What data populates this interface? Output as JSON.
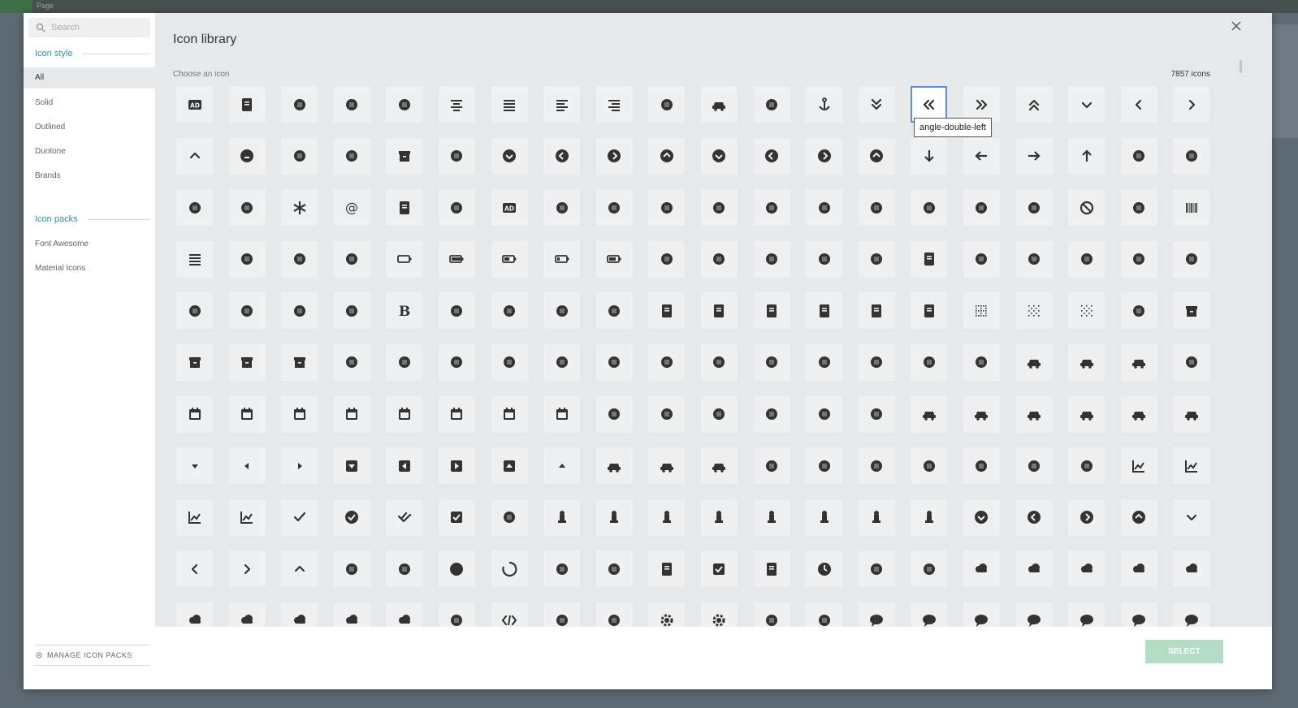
{
  "background": {
    "page_label": "Page"
  },
  "modal": {
    "title": "Icon library",
    "subtitle": "Choose an icon",
    "count_label": "7857 icons",
    "select_label": "SELECT",
    "tooltip": "angle-double-left"
  },
  "search": {
    "placeholder": "Search"
  },
  "sidebar": {
    "icon_style_heading": "Icon style",
    "styles": [
      "All",
      "Solid",
      "Outlined",
      "Duotone",
      "Brands"
    ],
    "packs_heading": "Icon packs",
    "packs": [
      "Font Awesome",
      "Material Icons"
    ],
    "manage_label": "MANAGE ICON PACKS"
  },
  "colors": {
    "accent": "#3a8aa3",
    "icon": "#333333",
    "select_button": "#b5dcc5",
    "selected_border": "#5b8fcf"
  },
  "icons": [
    "ad",
    "address-book",
    "address-card",
    "adjust",
    "air-freshener",
    "align-center",
    "align-justify",
    "align-left",
    "align-right",
    "allergies",
    "ambulance",
    "american-sign-language-interpreting",
    "anchor",
    "angle-double-down",
    "angle-double-left",
    "angle-double-right",
    "angle-double-up",
    "angle-down",
    "angle-left",
    "angle-right",
    "angle-up",
    "angry",
    "ankh",
    "apple-alt",
    "archive",
    "archway",
    "arrow-alt-circle-down",
    "arrow-alt-circle-left",
    "arrow-alt-circle-right",
    "arrow-alt-circle-up",
    "arrow-circle-down",
    "arrow-circle-left",
    "arrow-circle-right",
    "arrow-circle-up",
    "arrow-down",
    "arrow-left",
    "arrow-right",
    "arrow-up",
    "arrows-alt",
    "arrows-alt-h",
    "arrows-alt-v",
    "assistive-listening-systems",
    "asterisk",
    "at",
    "atlas",
    "atom",
    "audio-description",
    "award",
    "baby",
    "baby-carriage",
    "backspace",
    "backward",
    "bacon",
    "bahai",
    "balance-scale",
    "balance-scale-left",
    "balance-scale-right",
    "ban",
    "band-aid",
    "barcode",
    "bars",
    "baseball-ball",
    "basketball-ball",
    "bath",
    "battery-empty",
    "battery-full",
    "battery-half",
    "battery-quarter",
    "battery-three-quarters",
    "bed",
    "beer",
    "bell",
    "bell-slash",
    "bezier-curve",
    "bible",
    "bicycle",
    "biking",
    "binoculars",
    "biohazard",
    "birthday-cake",
    "blender",
    "blender-phone",
    "blind",
    "blog",
    "bold",
    "bolt",
    "bomb",
    "bone",
    "bong",
    "book",
    "book-dead",
    "book-medical",
    "book-open",
    "book-reader",
    "bookmark",
    "border-all",
    "border-none",
    "border-style",
    "bowling-ball",
    "box",
    "box-open",
    "boxes",
    "boxes-stacked",
    "braille",
    "brain",
    "bread-slice",
    "briefcase",
    "briefcase-medical",
    "broadcast-tower",
    "broom",
    "brush",
    "bug",
    "building",
    "bullhorn",
    "bullseye",
    "burn",
    "bus",
    "bus-alt",
    "business-time",
    "calculator",
    "calendar",
    "calendar-alt",
    "calendar-check",
    "calendar-day",
    "calendar-minus",
    "calendar-plus",
    "calendar-times",
    "calendar-week",
    "camera",
    "camera-retro",
    "campground",
    "candy-cane",
    "cannabis",
    "capsules",
    "car",
    "car-alt",
    "car-battery",
    "car-crash",
    "car-side",
    "caravan",
    "caret-down",
    "caret-left",
    "caret-right",
    "caret-square-down",
    "caret-square-left",
    "caret-square-right",
    "caret-square-up",
    "caret-up",
    "carrot",
    "cart-arrow-down",
    "cart-plus",
    "cash-register",
    "cat",
    "certificate",
    "chair",
    "chalkboard",
    "chalkboard-teacher",
    "charging-station",
    "chart-area",
    "chart-bar",
    "chart-line",
    "chart-pie",
    "check",
    "check-circle",
    "check-double",
    "check-square",
    "cheese",
    "chess",
    "chess-bishop",
    "chess-board",
    "chess-king",
    "chess-knight",
    "chess-pawn",
    "chess-queen",
    "chess-rook",
    "chevron-circle-down",
    "chevron-circle-left",
    "chevron-circle-right",
    "chevron-circle-up",
    "chevron-down",
    "chevron-left",
    "chevron-right",
    "chevron-up",
    "child",
    "church",
    "circle",
    "circle-notch",
    "city",
    "clinic-medical",
    "clipboard",
    "clipboard-check",
    "clipboard-list",
    "clock",
    "clone",
    "closed-captioning",
    "cloud",
    "cloud-download-alt",
    "cloud-meatball",
    "cloud-moon",
    "cloud-moon-rain",
    "cloud-rain",
    "cloud-showers-heavy",
    "cloud-sun",
    "cloud-sun-rain",
    "cloud-upload-alt",
    "cocktail",
    "code",
    "code-branch",
    "coffee",
    "cog",
    "cogs",
    "coins",
    "columns",
    "comment",
    "comment-alt",
    "comment-dollar",
    "comment-dots",
    "comment-medical",
    "comment-slash",
    "comments"
  ]
}
